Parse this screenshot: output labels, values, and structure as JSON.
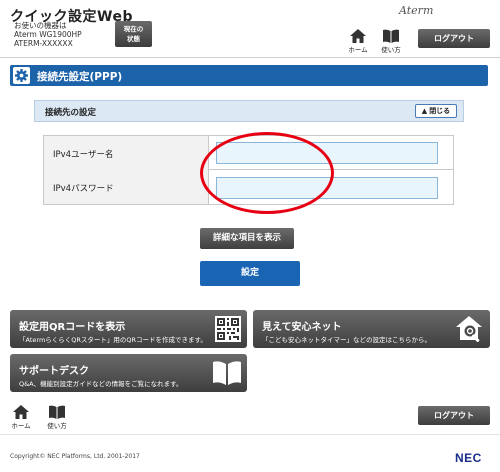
{
  "header": {
    "app_title": "クイック設定Web",
    "device_label": "お使いの機器は",
    "device_model": "Aterm WG1900HP",
    "device_id": "ATERM-XXXXXX",
    "status_line1": "現在の",
    "status_line2": "状態",
    "brand": "Aterm",
    "home_label": "ホーム",
    "guide_label": "使い方",
    "logout_label": "ログアウト"
  },
  "section": {
    "title": "接続先設定(PPP)"
  },
  "panel": {
    "title": "接続先の設定",
    "collapse_label": "閉じる"
  },
  "form": {
    "user_label": "IPv4ユーザー名",
    "user_value": "",
    "password_label": "IPv4パスワード",
    "password_value": ""
  },
  "actions": {
    "detail_label": "詳細な項目を表示",
    "submit_label": "設定"
  },
  "cards": {
    "qr": {
      "title": "設定用QRコードを表示",
      "desc": "「AtermらくらくQRスタート」用のQRコードを作成できます。"
    },
    "safety": {
      "title": "見えて安心ネット",
      "desc": "「こども安心ネットタイマー」などの設定はこちらから。"
    },
    "support": {
      "title": "サポートデスク",
      "desc": "Q&A、機能別設定ガイドなどの情報をご覧になれます。"
    }
  },
  "footer": {
    "home_label": "ホーム",
    "guide_label": "使い方",
    "logout_label": "ログアウト",
    "copyright": "Copyright© NEC Platforms, Ltd. 2001-2017",
    "logo": "NEC"
  },
  "colors": {
    "accent_blue": "#1d63aa",
    "button_gray": "#4a4a4a",
    "annotation_red": "#e60012",
    "nec_blue": "#1a2d8c"
  }
}
